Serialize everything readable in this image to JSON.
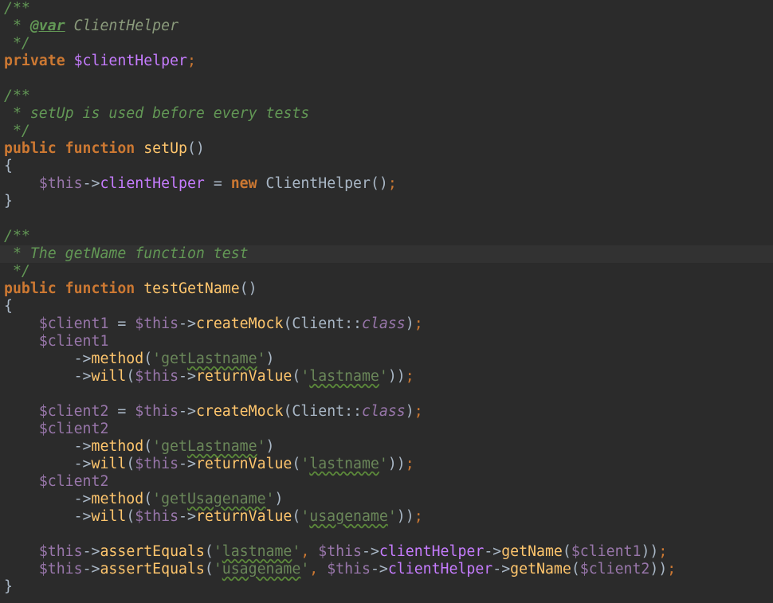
{
  "editor": {
    "current_line_index": 14,
    "lines": [
      [
        {
          "t": "/**",
          "c": "comment"
        }
      ],
      [
        {
          "t": " * ",
          "c": "comment"
        },
        {
          "t": "@var",
          "c": "doctag"
        },
        {
          "t": " ClientHelper",
          "c": "doctype"
        }
      ],
      [
        {
          "t": " */",
          "c": "comment"
        }
      ],
      [
        {
          "t": "private ",
          "c": "keyword"
        },
        {
          "t": "$clientHelper",
          "c": "field"
        },
        {
          "t": ";",
          "c": "punct"
        }
      ],
      [],
      [
        {
          "t": "/**",
          "c": "comment"
        }
      ],
      [
        {
          "t": " * setUp is used before every tests",
          "c": "comment"
        }
      ],
      [
        {
          "t": " */",
          "c": "comment"
        }
      ],
      [
        {
          "t": "public ",
          "c": "keyword"
        },
        {
          "t": "function ",
          "c": "keyword"
        },
        {
          "t": "setUp",
          "c": "fn"
        },
        {
          "t": "()",
          "c": "plain"
        }
      ],
      [
        {
          "t": "{",
          "c": "plain"
        }
      ],
      [
        {
          "t": "    ",
          "c": "plain"
        },
        {
          "t": "$this",
          "c": "var"
        },
        {
          "t": "->",
          "c": "plain"
        },
        {
          "t": "clientHelper",
          "c": "field"
        },
        {
          "t": " = ",
          "c": "plain"
        },
        {
          "t": "new ",
          "c": "keyword"
        },
        {
          "t": "ClientHelper",
          "c": "plain"
        },
        {
          "t": "()",
          "c": "plain"
        },
        {
          "t": ";",
          "c": "punct"
        }
      ],
      [
        {
          "t": "}",
          "c": "plain"
        }
      ],
      [],
      [
        {
          "t": "/**",
          "c": "comment"
        }
      ],
      [
        {
          "t": " * The getName function test",
          "c": "comment"
        }
      ],
      [
        {
          "t": " */",
          "c": "comment"
        }
      ],
      [
        {
          "t": "public ",
          "c": "keyword"
        },
        {
          "t": "function ",
          "c": "keyword"
        },
        {
          "t": "testGetName",
          "c": "fn"
        },
        {
          "t": "()",
          "c": "plain"
        }
      ],
      [
        {
          "t": "{",
          "c": "plain"
        }
      ],
      [
        {
          "t": "    ",
          "c": "plain"
        },
        {
          "t": "$client1",
          "c": "var"
        },
        {
          "t": " = ",
          "c": "plain"
        },
        {
          "t": "$this",
          "c": "var"
        },
        {
          "t": "->",
          "c": "plain"
        },
        {
          "t": "createMock",
          "c": "method"
        },
        {
          "t": "(",
          "c": "plain"
        },
        {
          "t": "Client",
          "c": "plain"
        },
        {
          "t": "::",
          "c": "plain"
        },
        {
          "t": "class",
          "c": "italic"
        },
        {
          "t": ")",
          "c": "plain"
        },
        {
          "t": ";",
          "c": "punct"
        }
      ],
      [
        {
          "t": "    ",
          "c": "plain"
        },
        {
          "t": "$client1",
          "c": "var"
        }
      ],
      [
        {
          "t": "        ->",
          "c": "plain"
        },
        {
          "t": "method",
          "c": "method"
        },
        {
          "t": "(",
          "c": "plain"
        },
        {
          "t": "'get",
          "c": "string"
        },
        {
          "t": "Lastname",
          "c": "string typo"
        },
        {
          "t": "'",
          "c": "string"
        },
        {
          "t": ")",
          "c": "plain"
        }
      ],
      [
        {
          "t": "        ->",
          "c": "plain"
        },
        {
          "t": "will",
          "c": "method"
        },
        {
          "t": "(",
          "c": "plain"
        },
        {
          "t": "$this",
          "c": "var"
        },
        {
          "t": "->",
          "c": "plain"
        },
        {
          "t": "returnValue",
          "c": "method"
        },
        {
          "t": "(",
          "c": "plain"
        },
        {
          "t": "'",
          "c": "string"
        },
        {
          "t": "lastname",
          "c": "string typo"
        },
        {
          "t": "'",
          "c": "string"
        },
        {
          "t": "))",
          "c": "plain"
        },
        {
          "t": ";",
          "c": "punct"
        }
      ],
      [],
      [
        {
          "t": "    ",
          "c": "plain"
        },
        {
          "t": "$client2",
          "c": "var"
        },
        {
          "t": " = ",
          "c": "plain"
        },
        {
          "t": "$this",
          "c": "var"
        },
        {
          "t": "->",
          "c": "plain"
        },
        {
          "t": "createMock",
          "c": "method"
        },
        {
          "t": "(",
          "c": "plain"
        },
        {
          "t": "Client",
          "c": "plain"
        },
        {
          "t": "::",
          "c": "plain"
        },
        {
          "t": "class",
          "c": "italic"
        },
        {
          "t": ")",
          "c": "plain"
        },
        {
          "t": ";",
          "c": "punct"
        }
      ],
      [
        {
          "t": "    ",
          "c": "plain"
        },
        {
          "t": "$client2",
          "c": "var"
        }
      ],
      [
        {
          "t": "        ->",
          "c": "plain"
        },
        {
          "t": "method",
          "c": "method"
        },
        {
          "t": "(",
          "c": "plain"
        },
        {
          "t": "'get",
          "c": "string"
        },
        {
          "t": "Lastname",
          "c": "string typo"
        },
        {
          "t": "'",
          "c": "string"
        },
        {
          "t": ")",
          "c": "plain"
        }
      ],
      [
        {
          "t": "        ->",
          "c": "plain"
        },
        {
          "t": "will",
          "c": "method"
        },
        {
          "t": "(",
          "c": "plain"
        },
        {
          "t": "$this",
          "c": "var"
        },
        {
          "t": "->",
          "c": "plain"
        },
        {
          "t": "returnValue",
          "c": "method"
        },
        {
          "t": "(",
          "c": "plain"
        },
        {
          "t": "'",
          "c": "string"
        },
        {
          "t": "lastname",
          "c": "string typo"
        },
        {
          "t": "'",
          "c": "string"
        },
        {
          "t": "))",
          "c": "plain"
        },
        {
          "t": ";",
          "c": "punct"
        }
      ],
      [
        {
          "t": "    ",
          "c": "plain"
        },
        {
          "t": "$client2",
          "c": "var"
        }
      ],
      [
        {
          "t": "        ->",
          "c": "plain"
        },
        {
          "t": "method",
          "c": "method"
        },
        {
          "t": "(",
          "c": "plain"
        },
        {
          "t": "'get",
          "c": "string"
        },
        {
          "t": "Usagename",
          "c": "string typo"
        },
        {
          "t": "'",
          "c": "string"
        },
        {
          "t": ")",
          "c": "plain"
        }
      ],
      [
        {
          "t": "        ->",
          "c": "plain"
        },
        {
          "t": "will",
          "c": "method"
        },
        {
          "t": "(",
          "c": "plain"
        },
        {
          "t": "$this",
          "c": "var"
        },
        {
          "t": "->",
          "c": "plain"
        },
        {
          "t": "returnValue",
          "c": "method"
        },
        {
          "t": "(",
          "c": "plain"
        },
        {
          "t": "'",
          "c": "string"
        },
        {
          "t": "usagename",
          "c": "string typo"
        },
        {
          "t": "'",
          "c": "string"
        },
        {
          "t": "))",
          "c": "plain"
        },
        {
          "t": ";",
          "c": "punct"
        }
      ],
      [],
      [
        {
          "t": "    ",
          "c": "plain"
        },
        {
          "t": "$this",
          "c": "var"
        },
        {
          "t": "->",
          "c": "plain"
        },
        {
          "t": "assertEquals",
          "c": "method"
        },
        {
          "t": "(",
          "c": "plain"
        },
        {
          "t": "'",
          "c": "string"
        },
        {
          "t": "lastname",
          "c": "string typo"
        },
        {
          "t": "'",
          "c": "string"
        },
        {
          "t": ", ",
          "c": "punct"
        },
        {
          "t": "$this",
          "c": "var"
        },
        {
          "t": "->",
          "c": "plain"
        },
        {
          "t": "clientHelper",
          "c": "field"
        },
        {
          "t": "->",
          "c": "plain"
        },
        {
          "t": "getName",
          "c": "method"
        },
        {
          "t": "(",
          "c": "plain"
        },
        {
          "t": "$client1",
          "c": "var"
        },
        {
          "t": "))",
          "c": "plain"
        },
        {
          "t": ";",
          "c": "punct"
        }
      ],
      [
        {
          "t": "    ",
          "c": "plain"
        },
        {
          "t": "$this",
          "c": "var"
        },
        {
          "t": "->",
          "c": "plain"
        },
        {
          "t": "assertEquals",
          "c": "method"
        },
        {
          "t": "(",
          "c": "plain"
        },
        {
          "t": "'",
          "c": "string"
        },
        {
          "t": "usagename",
          "c": "string typo"
        },
        {
          "t": "'",
          "c": "string"
        },
        {
          "t": ", ",
          "c": "punct"
        },
        {
          "t": "$this",
          "c": "var"
        },
        {
          "t": "->",
          "c": "plain"
        },
        {
          "t": "clientHelper",
          "c": "field"
        },
        {
          "t": "->",
          "c": "plain"
        },
        {
          "t": "getName",
          "c": "method"
        },
        {
          "t": "(",
          "c": "plain"
        },
        {
          "t": "$client2",
          "c": "var"
        },
        {
          "t": "))",
          "c": "plain"
        },
        {
          "t": ";",
          "c": "punct"
        }
      ],
      [
        {
          "t": "}",
          "c": "plain"
        }
      ]
    ]
  },
  "colors": {
    "background": "#2b2b2b",
    "current_line": "#323232",
    "comment": "#629755",
    "keyword": "#cc7832",
    "variable": "#9876aa",
    "field": "#c67cff",
    "function": "#ffc66d",
    "string": "#6a8759",
    "default": "#a9b7c6"
  }
}
